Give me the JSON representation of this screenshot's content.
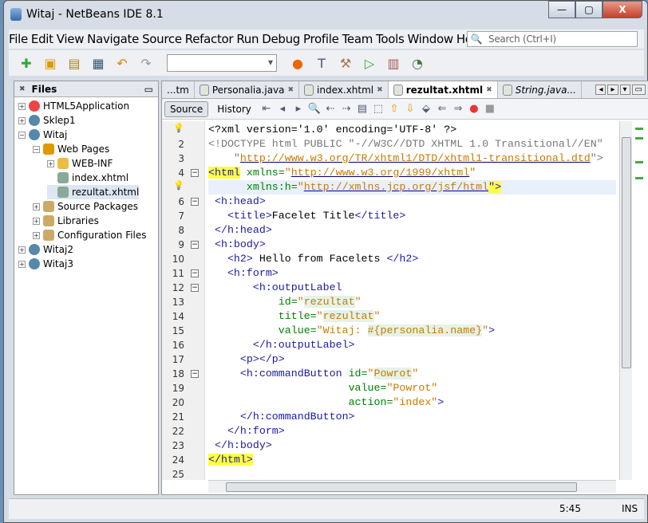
{
  "window": {
    "title": "Witaj - NetBeans IDE 8.1",
    "minimize": "—",
    "maximize": "▢",
    "close": "X"
  },
  "menu": [
    "File",
    "Edit",
    "View",
    "Navigate",
    "Source",
    "Refactor",
    "Run",
    "Debug",
    "Profile",
    "Team",
    "Tools",
    "Window",
    "Help"
  ],
  "search": {
    "placeholder": "Search (Ctrl+I)"
  },
  "files_panel": {
    "title": "Files",
    "tree": [
      {
        "label": "HTML5Application",
        "level": 0,
        "expander": "+",
        "icon": "html5-project-icon"
      },
      {
        "label": "Sklep1",
        "level": 0,
        "expander": "+",
        "icon": "web-project-icon"
      },
      {
        "label": "Witaj",
        "level": 0,
        "expander": "−",
        "icon": "web-project-icon"
      },
      {
        "label": "Web Pages",
        "level": 1,
        "expander": "−",
        "icon": "web-folder-icon"
      },
      {
        "label": "WEB-INF",
        "level": 2,
        "expander": "+",
        "icon": "folder-icon"
      },
      {
        "label": "index.xhtml",
        "level": 2,
        "expander": "",
        "icon": "xhtml-file-icon"
      },
      {
        "label": "rezultat.xhtml",
        "level": 2,
        "expander": "",
        "icon": "xhtml-file-icon",
        "selected": true
      },
      {
        "label": "Source Packages",
        "level": 1,
        "expander": "+",
        "icon": "package-folder-icon"
      },
      {
        "label": "Libraries",
        "level": 1,
        "expander": "+",
        "icon": "library-folder-icon"
      },
      {
        "label": "Configuration Files",
        "level": 1,
        "expander": "+",
        "icon": "config-folder-icon"
      },
      {
        "label": "Witaj2",
        "level": 0,
        "expander": "+",
        "icon": "web-project-icon"
      },
      {
        "label": "Witaj3",
        "level": 0,
        "expander": "+",
        "icon": "web-project-icon"
      }
    ]
  },
  "tabs": [
    {
      "label": "...tm"
    },
    {
      "label": "Personalia.java"
    },
    {
      "label": "index.xhtml"
    },
    {
      "label": "rezultat.xhtml",
      "active": true
    },
    {
      "label": "String.java..."
    }
  ],
  "editor_toolbar": {
    "source": "Source",
    "history": "History"
  },
  "code": [
    {
      "n": "",
      "bulb": true,
      "fold": "",
      "seg": [
        [
          "pi",
          "<?xml version='1.0' encoding='UTF-8' ?>"
        ]
      ]
    },
    {
      "n": "2",
      "seg": [
        [
          "doc",
          "<!DOCTYPE html PUBLIC \"-//W3C//DTD XHTML 1.0 Transitional//EN\""
        ]
      ]
    },
    {
      "n": "3",
      "seg": [
        [
          "doc",
          "    \""
        ],
        [
          "url",
          "http://www.w3.org/TR/xhtml1/DTD/xhtml1-transitional.dtd"
        ],
        [
          "doc",
          "\">"
        ]
      ]
    },
    {
      "n": "4",
      "fold": "−",
      "seg": [
        [
          "hl",
          "<html"
        ],
        [
          "txt",
          " "
        ],
        [
          "attr",
          "xmlns="
        ],
        [
          "val",
          "\""
        ],
        [
          "url",
          "http://www.w3.org/1999/xhtml"
        ],
        [
          "val",
          "\""
        ]
      ]
    },
    {
      "n": "",
      "bulb": true,
      "current": true,
      "seg": [
        [
          "txt",
          "      "
        ],
        [
          "attr",
          "xmlns:h="
        ],
        [
          "val",
          "\""
        ],
        [
          "url",
          "http://xmlns.jcp.org/jsf/html"
        ],
        [
          "hl",
          "\">"
        ]
      ]
    },
    {
      "n": "6",
      "fold": "−",
      "seg": [
        [
          "tag",
          " <h:head>"
        ]
      ]
    },
    {
      "n": "7",
      "seg": [
        [
          "tag",
          "   <title>"
        ],
        [
          "txt",
          "Facelet Title"
        ],
        [
          "tag",
          "</title>"
        ]
      ]
    },
    {
      "n": "8",
      "seg": [
        [
          "tag",
          " </h:head>"
        ]
      ]
    },
    {
      "n": "9",
      "fold": "−",
      "seg": [
        [
          "tag",
          " <h:body>"
        ]
      ]
    },
    {
      "n": "10",
      "seg": [
        [
          "tag",
          "   <h2>"
        ],
        [
          "txt",
          " Hello from Facelets "
        ],
        [
          "tag",
          "</h2>"
        ]
      ]
    },
    {
      "n": "11",
      "fold": "−",
      "seg": [
        [
          "tag",
          "   <h:form>"
        ]
      ]
    },
    {
      "n": "12",
      "fold": "−",
      "seg": [
        [
          "tag",
          "       <h:outputLabel"
        ]
      ]
    },
    {
      "n": "13",
      "seg": [
        [
          "txt",
          "           "
        ],
        [
          "attr",
          "id="
        ],
        [
          "val",
          "\""
        ],
        [
          "vbg",
          "rezultat"
        ],
        [
          "val",
          "\""
        ]
      ]
    },
    {
      "n": "14",
      "seg": [
        [
          "txt",
          "           "
        ],
        [
          "attr",
          "title="
        ],
        [
          "val",
          "\""
        ],
        [
          "vbg",
          "rezultat"
        ],
        [
          "val",
          "\""
        ]
      ]
    },
    {
      "n": "15",
      "seg": [
        [
          "txt",
          "           "
        ],
        [
          "attr",
          "value="
        ],
        [
          "val",
          "\"Witaj: "
        ],
        [
          "vbg",
          "#{personalia.name}"
        ],
        [
          "val",
          "\""
        ],
        [
          "tag",
          ">"
        ]
      ]
    },
    {
      "n": "16",
      "seg": [
        [
          "tag",
          "       </h:outputLabel>"
        ]
      ]
    },
    {
      "n": "17",
      "seg": [
        [
          "tag",
          "     <p></p>"
        ]
      ]
    },
    {
      "n": "18",
      "fold": "−",
      "seg": [
        [
          "tag",
          "     <h:commandButton"
        ],
        [
          "txt",
          " "
        ],
        [
          "attr",
          "id="
        ],
        [
          "val",
          "\""
        ],
        [
          "vbg",
          "Powrot"
        ],
        [
          "val",
          "\""
        ]
      ]
    },
    {
      "n": "19",
      "seg": [
        [
          "txt",
          "                      "
        ],
        [
          "attr",
          "value="
        ],
        [
          "val",
          "\"Powrot\""
        ]
      ]
    },
    {
      "n": "20",
      "seg": [
        [
          "txt",
          "                      "
        ],
        [
          "attr",
          "action="
        ],
        [
          "val",
          "\"index\""
        ],
        [
          "tag",
          ">"
        ]
      ]
    },
    {
      "n": "21",
      "seg": [
        [
          "tag",
          "     </h:commandButton>"
        ]
      ]
    },
    {
      "n": "22",
      "seg": [
        [
          "tag",
          "   </h:form>"
        ]
      ]
    },
    {
      "n": "23",
      "seg": [
        [
          "tag",
          " </h:body>"
        ]
      ]
    },
    {
      "n": "24",
      "seg": [
        [
          "hl",
          "</html>"
        ]
      ]
    },
    {
      "n": "25",
      "seg": []
    }
  ],
  "status": {
    "position": "5:45",
    "mode": "INS"
  }
}
